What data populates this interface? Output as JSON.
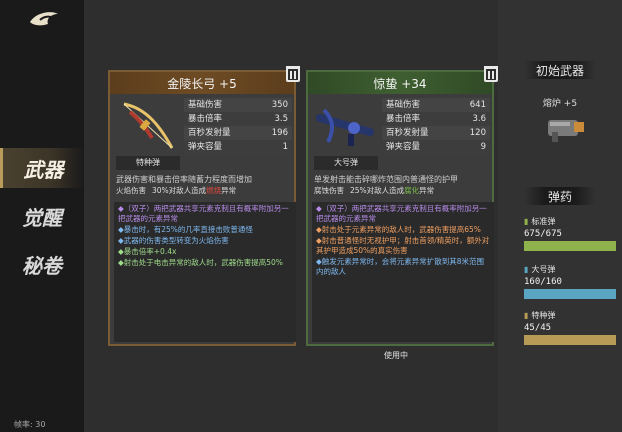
{
  "sidebar": {
    "items": [
      {
        "label": "武器",
        "active": true
      },
      {
        "label": "觉醒",
        "active": false
      },
      {
        "label": "秘卷",
        "active": false
      }
    ],
    "fps": "帧率: 30"
  },
  "weapons": [
    {
      "name": "金陵长弓 +5",
      "ammo_type": "特种弹",
      "stats": [
        {
          "label": "基础伤害",
          "value": "350"
        },
        {
          "label": "暴击倍率",
          "value": "3.5"
        },
        {
          "label": "百秒发射量",
          "value": "196"
        },
        {
          "label": "弹夹容量",
          "value": "1"
        }
      ],
      "desc": "武器伤害和暴击倍率随蓄力程度而增加",
      "desc_a": "火焰伤害",
      "desc_b_pre": "30%对敌人造成",
      "desc_b_hl": "燃烧",
      "desc_b_post": "异常",
      "traits": [
        {
          "style": "purple",
          "text": "◆（双子）两把武器共享元素克制且有概率附加另一把武器的元素异常"
        },
        {
          "style": "blue",
          "text": "◆暴击时，有25%的几率直接击败普通怪"
        },
        {
          "style": "blue",
          "text": "◆武器的伤害类型转变为火焰伤害"
        },
        {
          "style": "green",
          "text": "◆暴击倍率+0.4x"
        },
        {
          "style": "green",
          "text": "◆射击处于电击异常的敌人时，武器伤害提高50%"
        }
      ]
    },
    {
      "name": "惊蛰 +34",
      "ammo_type": "大号弹",
      "stats": [
        {
          "label": "基础伤害",
          "value": "641"
        },
        {
          "label": "暴击倍率",
          "value": "3.6"
        },
        {
          "label": "百秒发射量",
          "value": "120"
        },
        {
          "label": "弹夹容量",
          "value": "9"
        }
      ],
      "desc": "单发射击能击碎哪炸范围内普通怪的护甲",
      "desc_a": "腐蚀伤害",
      "desc_b_pre": "25%对敌人造成",
      "desc_b_hl": "腐化",
      "desc_b_post": "异常",
      "traits": [
        {
          "style": "purple",
          "text": "◆（双子）两把武器共享元素克制且有概率附加另一把武器的元素异常"
        },
        {
          "style": "orange",
          "text": "◆射击处于元素异常的敌人时，武器伤害提高65%"
        },
        {
          "style": "orange",
          "text": "◆射击普通怪时无视护甲；射击首领/精英时，额外对其护甲造成50%的真实伤害"
        },
        {
          "style": "blue",
          "text": "◆触发元素异常时，会将元素异常扩散到其8米范围内的敌人"
        }
      ]
    }
  ],
  "in_use": "使用中",
  "right_panel": {
    "initial_weapon_title": "初始武器",
    "initial_weapon_name": "熔炉 +5",
    "ammo_title": "弹药",
    "ammo": [
      {
        "name": "标准弹",
        "count": "675/675",
        "fill": 1.0,
        "color": "#8fb24c"
      },
      {
        "name": "大号弹",
        "count": "160/160",
        "fill": 1.0,
        "color": "#5aa6c2"
      },
      {
        "name": "特种弹",
        "count": "45/45",
        "fill": 1.0,
        "color": "#b79a56"
      }
    ]
  }
}
